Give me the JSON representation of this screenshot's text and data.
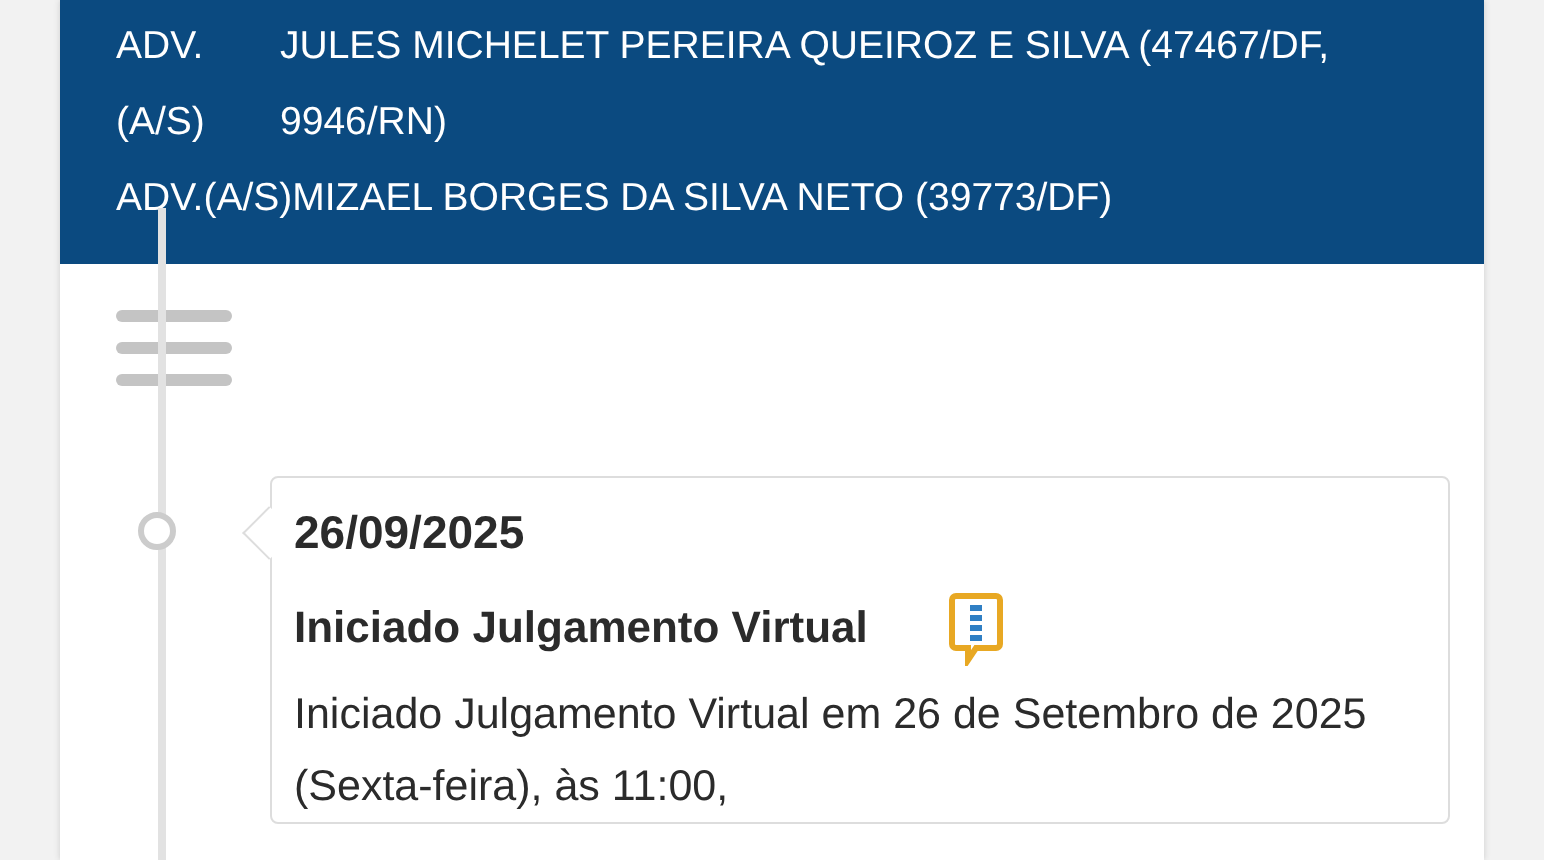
{
  "header": {
    "parties": [
      {
        "kind": "columns",
        "label": "ADV. (A/S)",
        "name": "JULES MICHELET PEREIRA QUEIROZ E SILVA (47467/DF, 9946/RN)"
      },
      {
        "kind": "inline",
        "label": "ADV.(A/S)",
        "name": "MIZAEL BORGES DA SILVA NETO (39773/DF)"
      }
    ]
  },
  "timeline": {
    "events": [
      {
        "date": "26/09/2025",
        "title": "Iniciado Julgamento Virtual",
        "body": "Iniciado Julgamento Virtual em 26 de Setembro de 2025 (Sexta-feira), às 11:00,"
      }
    ]
  }
}
